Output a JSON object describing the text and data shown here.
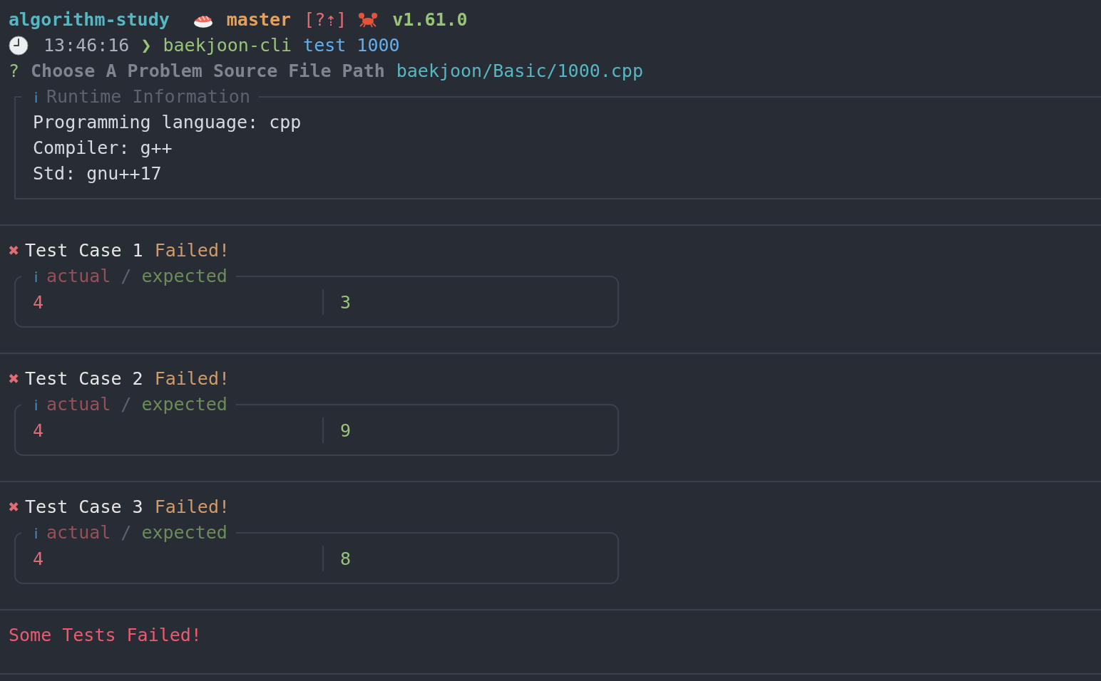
{
  "prompt": {
    "directory": "algorithm-study",
    "branch": "master",
    "git_status": "[?⇡]",
    "version": "v1.61.0",
    "time": "13:46:16",
    "chevron": "❯",
    "command": "baekjoon-cli",
    "args": "test 1000"
  },
  "question": {
    "mark": "?",
    "label": "Choose A Problem Source File Path",
    "answer": "baekjoon/Basic/1000.cpp"
  },
  "runtime": {
    "icon": "ℹ",
    "title": "Runtime Information",
    "lines": [
      "Programming language: cpp",
      "Compiler: g++",
      "Std: gnu++17"
    ]
  },
  "test_cases": [
    {
      "mark": "✖",
      "label": "Test Case 1",
      "result": "Failed!",
      "info_icon": "ℹ",
      "actual_label": "actual",
      "separator": "/",
      "expected_label": "expected",
      "actual": "4",
      "expected": "3"
    },
    {
      "mark": "✖",
      "label": "Test Case 2",
      "result": "Failed!",
      "info_icon": "ℹ",
      "actual_label": "actual",
      "separator": "/",
      "expected_label": "expected",
      "actual": "4",
      "expected": "9"
    },
    {
      "mark": "✖",
      "label": "Test Case 3",
      "result": "Failed!",
      "info_icon": "ℹ",
      "actual_label": "actual",
      "separator": "/",
      "expected_label": "expected",
      "actual": "4",
      "expected": "8"
    }
  ],
  "summary": "Some Tests Failed!"
}
